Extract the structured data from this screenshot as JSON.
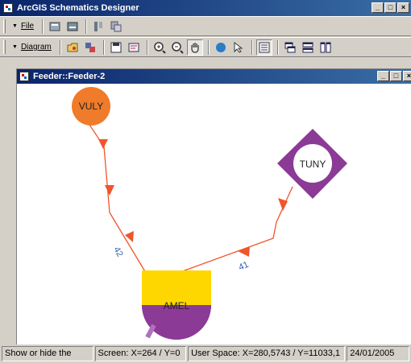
{
  "app": {
    "title": "ArcGIS Schematics Designer",
    "window_buttons": {
      "minimize": "_",
      "maximize": "□",
      "close": "×"
    }
  },
  "toolbar1": {
    "file_menu": "File",
    "icons": [
      "properties-icon",
      "properties-alt-icon",
      "layout-icon",
      "copy-icon"
    ]
  },
  "toolbar2": {
    "diagram_menu": "Diagram",
    "icons": [
      "open-diagram-icon",
      "diagram-templates-icon",
      "save-diagram-icon",
      "diagram-properties-icon",
      "zoom-in-icon",
      "zoom-out-icon",
      "pan-icon",
      "full-extent-icon",
      "select-icon",
      "table-of-contents-icon",
      "cascade-icon",
      "tile-horizontal-icon",
      "tile-vertical-icon"
    ]
  },
  "document": {
    "title": "Feeder::Feeder-2"
  },
  "diagram": {
    "nodes": [
      {
        "id": "VULY",
        "label": "VULY",
        "shape": "circle",
        "color": "#f07b2a"
      },
      {
        "id": "TUNY",
        "label": "TUNY",
        "shape": "diamond",
        "color": "#8b3a96"
      },
      {
        "id": "AMEL",
        "label": "AMEL",
        "shape": "half-rect-half-circle",
        "top_color": "#ffd700",
        "bottom_color": "#8b3a96"
      }
    ],
    "links": [
      {
        "label": "42",
        "from": "VULY",
        "to": "AMEL"
      },
      {
        "label": "41",
        "from": "TUNY",
        "to": "AMEL"
      }
    ],
    "link_color": "#f0552b",
    "label_color": "#2e5fa8"
  },
  "status": {
    "hint": "Show or hide the",
    "screen": "Screen: X=264 / Y=0",
    "user_space": "User Space: X=280,5743 / Y=11033,1",
    "date": "24/01/2005"
  }
}
